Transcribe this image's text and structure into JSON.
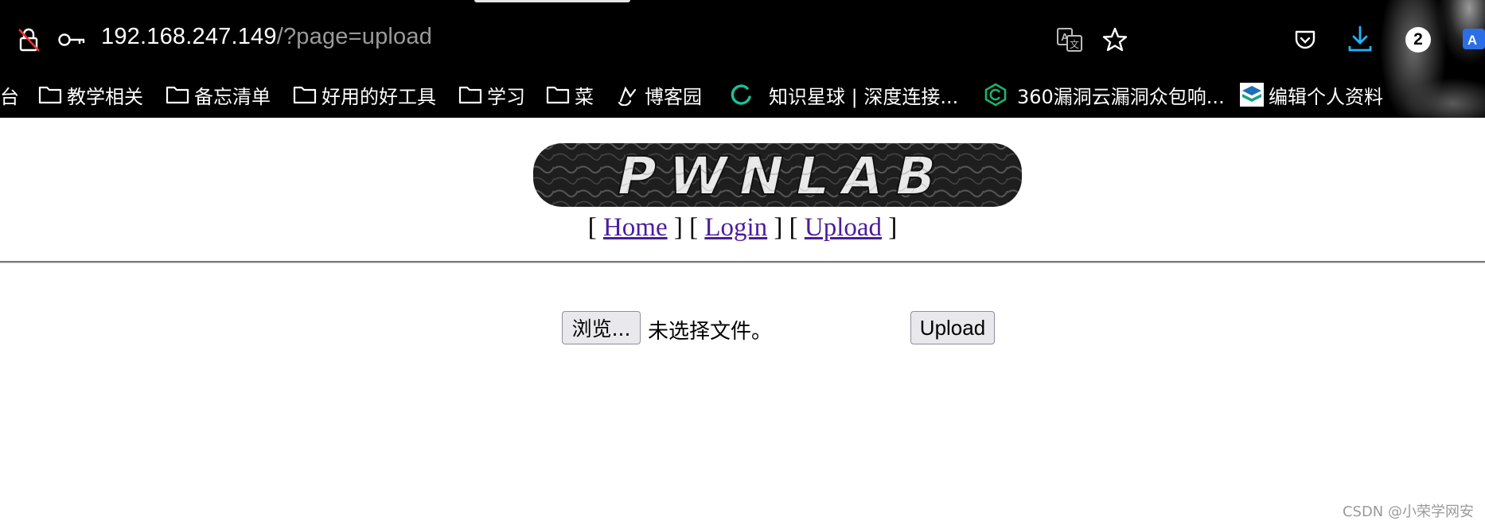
{
  "browser": {
    "url_host": "192.168.247.149",
    "url_path": "/?page=upload",
    "profile_count": "2",
    "bookmarks": [
      {
        "label": "台",
        "icon": "none"
      },
      {
        "label": "教学相关",
        "icon": "folder-icon"
      },
      {
        "label": "备忘清单",
        "icon": "folder-icon"
      },
      {
        "label": "好用的好工具",
        "icon": "folder-icon"
      },
      {
        "label": "学习",
        "icon": "folder-icon"
      },
      {
        "label": "菜",
        "icon": "folder-icon"
      },
      {
        "label": "博客园",
        "icon": "cnblogs-icon"
      },
      {
        "label": "知识星球 | 深度连接...",
        "icon": "zsxq-icon"
      },
      {
        "label": "360漏洞云漏洞众包响...",
        "icon": "360-icon"
      },
      {
        "label": "编辑个人资料",
        "icon": "profile-stack-icon"
      }
    ]
  },
  "page": {
    "logo_text": "PWNLAB",
    "nav": {
      "open": "[ ",
      "sep": " ] [ ",
      "close": " ]",
      "home": "Home",
      "login": "Login",
      "upload": "Upload"
    },
    "form": {
      "browse_label": "浏览...",
      "file_status": "未选择文件。",
      "upload_label": "Upload"
    },
    "watermark": "CSDN @小荣学网安"
  },
  "colors": {
    "link": "#4b1d9e",
    "chrome_bg": "#000000",
    "accent_download": "#1fb6ff"
  }
}
